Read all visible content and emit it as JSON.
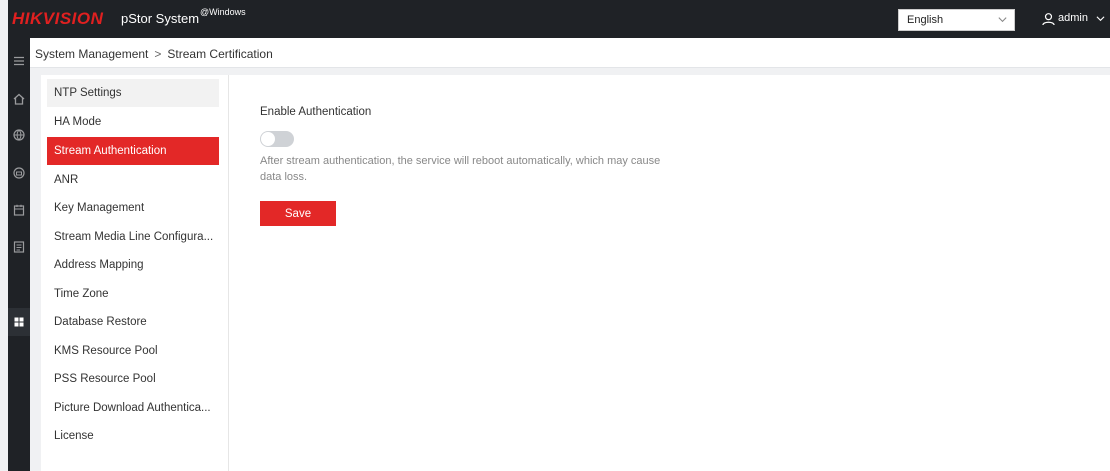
{
  "header": {
    "logo_text": "HIKVISION",
    "app_title": "pStor System",
    "app_subtitle": "@Windows",
    "language": "English",
    "user": "admin"
  },
  "nav_icons": [
    "menu-icon",
    "home-icon",
    "globe-icon",
    "printer-icon",
    "calendar-icon",
    "list-icon",
    "grid-icon"
  ],
  "breadcrumb": {
    "parent": "System Management",
    "separator": ">",
    "current": "Stream Certification"
  },
  "menu": {
    "items": [
      {
        "label": "NTP Settings"
      },
      {
        "label": "HA Mode"
      },
      {
        "label": "Stream Authentication"
      },
      {
        "label": "ANR"
      },
      {
        "label": "Key Management"
      },
      {
        "label": "Stream Media Line Configura..."
      },
      {
        "label": "Address Mapping"
      },
      {
        "label": "Time Zone"
      },
      {
        "label": "Database Restore"
      },
      {
        "label": "KMS Resource Pool"
      },
      {
        "label": "PSS Resource Pool"
      },
      {
        "label": "Picture Download Authentica..."
      },
      {
        "label": "License"
      }
    ],
    "active": "Stream Authentication"
  },
  "content": {
    "enable_label": "Enable Authentication",
    "toggle_on": false,
    "hint": "After stream authentication, the service will reboot automatically, which may cause data loss.",
    "save_label": "Save"
  },
  "colors": {
    "accent": "#e32827",
    "topbar": "#1f2226",
    "toggle_off": "#cfd2d6"
  }
}
